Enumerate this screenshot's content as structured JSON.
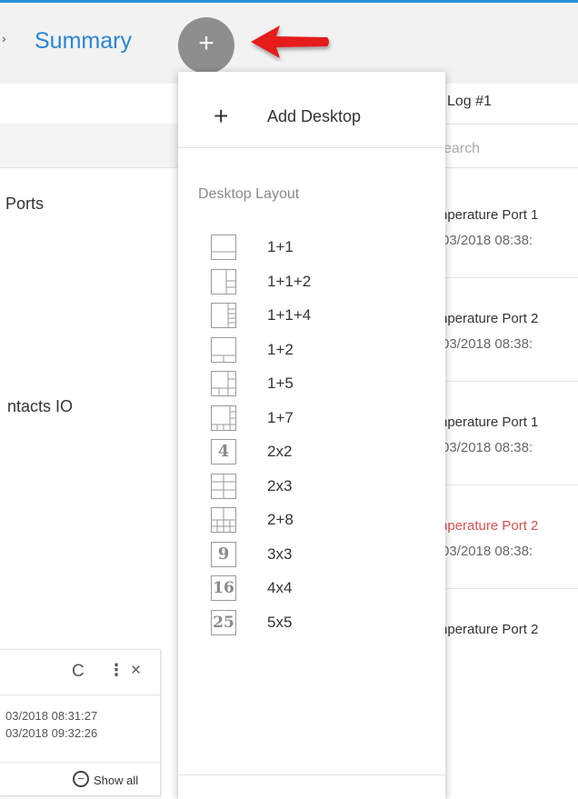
{
  "header": {
    "breadcrumb_chevron": "›",
    "title": "Summary",
    "add_button_symbol": "+"
  },
  "left_panel": {
    "item1": "Ports",
    "item2": "ntacts IO",
    "mini": {
      "refresh_icon": "C",
      "menu_icon": "⋮",
      "close_icon": "×",
      "time1": "03/2018 08:31:27",
      "time2": "03/2018 09:32:26",
      "show_all_icon": "−",
      "show_all": "Show all"
    }
  },
  "right_panel": {
    "title": "Log #1",
    "search_placeholder": "earch",
    "entries": [
      {
        "name": "nperature Port 1",
        "time": "03/2018 08:38:",
        "color": "#333333"
      },
      {
        "name": "nperature Port 2",
        "time": "03/2018 08:38:",
        "color": "#333333"
      },
      {
        "name": "nperature Port 1",
        "time": "03/2018 08:38:",
        "color": "#333333"
      },
      {
        "name": "nperature Port 2",
        "time": "03/2018 08:38:",
        "color": "#d9534f"
      },
      {
        "name": "nperature Port 2",
        "time": "",
        "color": "#333333"
      }
    ]
  },
  "dropdown": {
    "add_symbol": "+",
    "add_label": "Add Desktop",
    "section_title": "Desktop Layout",
    "layouts": [
      {
        "label": "1+1",
        "icon": "layout-1-1-icon"
      },
      {
        "label": "1+1+2",
        "icon": "layout-1-1-2-icon"
      },
      {
        "label": "1+1+4",
        "icon": "layout-1-1-4-icon"
      },
      {
        "label": "1+2",
        "icon": "layout-1-2-icon"
      },
      {
        "label": "1+5",
        "icon": "layout-1-5-icon"
      },
      {
        "label": "1+7",
        "icon": "layout-1-7-icon"
      },
      {
        "label": "2x2",
        "icon": "grid-number-icon",
        "icon_text": "4"
      },
      {
        "label": "2x3",
        "icon": "layout-2x3-icon"
      },
      {
        "label": "2+8",
        "icon": "layout-2-8-icon"
      },
      {
        "label": "3x3",
        "icon": "grid-number-icon",
        "icon_text": "9"
      },
      {
        "label": "4x4",
        "icon": "grid-number-icon",
        "icon_text": "16"
      },
      {
        "label": "5x5",
        "icon": "grid-number-icon",
        "icon_text": "25"
      }
    ]
  },
  "colors": {
    "accent": "#2a86d2",
    "arrow": "#e41e1e",
    "alert": "#d9534f"
  }
}
